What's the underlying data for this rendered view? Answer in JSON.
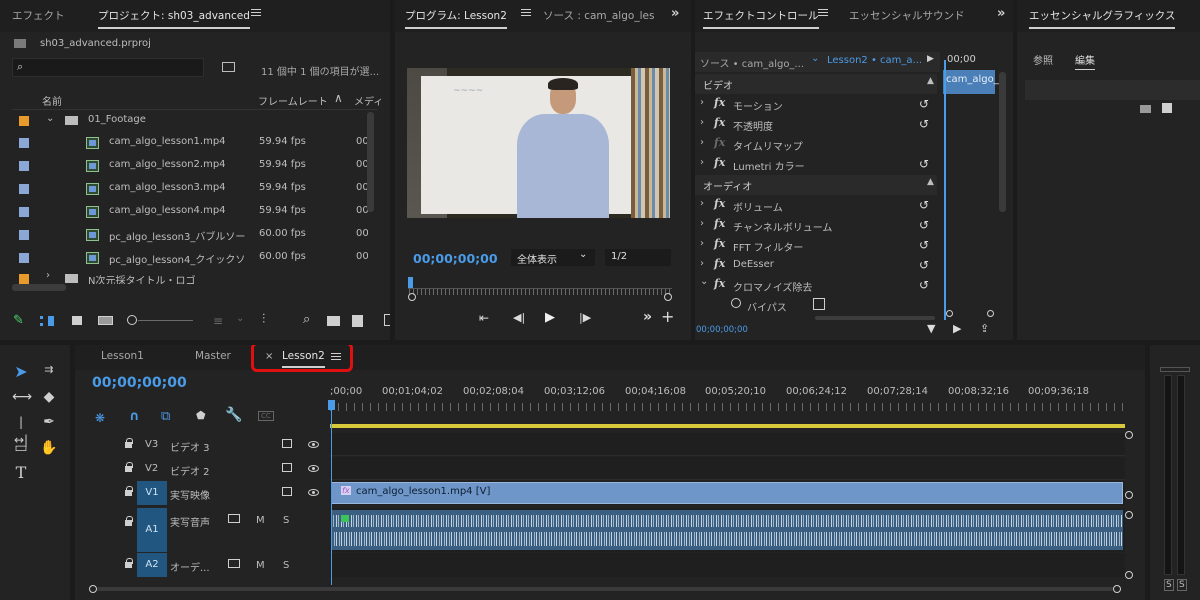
{
  "project": {
    "tabs": [
      "エフェクト",
      "プロジェクト: sh03_advanced"
    ],
    "file": "sh03_advanced.prproj",
    "selection_info": "11 個中 1 個の項目が選...",
    "col_name": "名前",
    "col_fps": "フレームレート",
    "col_media": "メディ",
    "folder1": "01_Footage",
    "items": [
      {
        "name": "cam_algo_lesson1.mp4",
        "fps": "59.94 fps",
        "extra": "00"
      },
      {
        "name": "cam_algo_lesson2.mp4",
        "fps": "59.94 fps",
        "extra": "00"
      },
      {
        "name": "cam_algo_lesson3.mp4",
        "fps": "59.94 fps",
        "extra": "00"
      },
      {
        "name": "cam_algo_lesson4.mp4",
        "fps": "59.94 fps",
        "extra": "00"
      },
      {
        "name": "pc_algo_lesson3_バブルソー",
        "fps": "60.00 fps",
        "extra": "00"
      },
      {
        "name": "pc_algo_lesson4_クイックソ",
        "fps": "60.00 fps",
        "extra": "00"
      }
    ],
    "folder2": "N次元採タイトル・ロゴ"
  },
  "program": {
    "tab": "プログラム: Lesson2",
    "source_tab": "ソース : cam_algo_les",
    "timecode": "00;00;00;00",
    "zoom": "全体表示",
    "resolution": "1/2"
  },
  "effect_controls": {
    "tab": "エフェクトコントロール",
    "essential_tab": "エッセンシャルサウンド",
    "source_label": "ソース • cam_algo_...",
    "seq_label": "Lesson2 • cam_a...",
    "time": "00;00",
    "clip_label": "cam_algo_",
    "video_header": "ビデオ",
    "video_items": [
      "モーション",
      "不透明度",
      "タイムリマップ",
      "Lumetri カラー"
    ],
    "audio_header": "オーディオ",
    "audio_items": [
      "ボリューム",
      "チャンネルボリューム",
      "FFT フィルター",
      "DeEsser",
      "クロマノイズ除去"
    ],
    "bypass": "バイパス",
    "bottom_time": "00;00;00;00"
  },
  "graphics": {
    "tab": "エッセンシャルグラフィックス",
    "browse": "参照",
    "edit": "編集"
  },
  "timeline": {
    "tabs": [
      "Lesson1",
      "Master",
      "Lesson2"
    ],
    "close": "×",
    "timecode": "00;00;00;00",
    "ruler": [
      ";00;00",
      "00;01;04;02",
      "00;02;08;04",
      "00;03;12;06",
      "00;04;16;08",
      "00;05;20;10",
      "00;06;24;12",
      "00;07;28;14",
      "00;08;32;16",
      "00;09;36;18"
    ],
    "cc": "CC",
    "tracks": [
      {
        "id": "V3",
        "name": "ビデオ 3"
      },
      {
        "id": "V2",
        "name": "ビデオ 2"
      },
      {
        "id": "V1",
        "name": "実写映像",
        "target": "V1"
      },
      {
        "id": "A1",
        "name": "実写音声",
        "target": "A1"
      },
      {
        "id": "A2",
        "name": "オーデ...",
        "target": "A2"
      }
    ],
    "m": "M",
    "s": "S",
    "clip": "cam_algo_lesson1.mp4 [V]",
    "fx": "fx"
  },
  "meter": {
    "s1": "S",
    "s2": "S"
  },
  "colors": {
    "accent": "#4a9be8",
    "highlight": "#e01010",
    "clip_video": "#6e96c8",
    "clip_audio": "#3a5f80"
  }
}
